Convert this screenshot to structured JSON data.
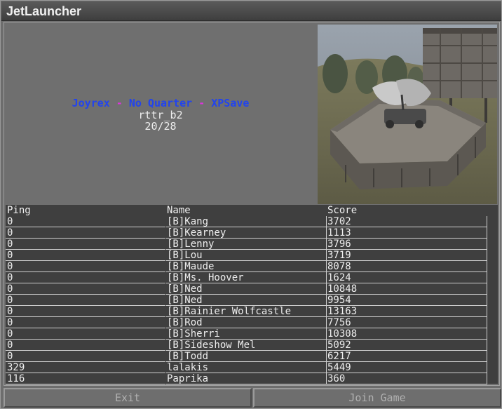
{
  "window": {
    "title": "JetLauncher"
  },
  "server": {
    "name_parts": [
      "Joyrex",
      "No Quarter",
      "XPSave"
    ],
    "separator": " - ",
    "map": "rttr_b2",
    "players": "20/28"
  },
  "table": {
    "headers": [
      "Ping",
      "Name",
      "Score"
    ],
    "rows": [
      [
        "0",
        "[B]Kang",
        "3702"
      ],
      [
        "0",
        "[B]Kearney",
        "1113"
      ],
      [
        "0",
        "[B]Lenny",
        "3796"
      ],
      [
        "0",
        "[B]Lou",
        "3719"
      ],
      [
        "0",
        "[B]Maude",
        "8078"
      ],
      [
        "0",
        "[B]Ms. Hoover",
        "1624"
      ],
      [
        "0",
        "[B]Ned",
        "10848"
      ],
      [
        "0",
        "[B]Ned",
        "9954"
      ],
      [
        "0",
        "[B]Rainier Wolfcastle",
        "13163"
      ],
      [
        "0",
        "[B]Rod",
        "7756"
      ],
      [
        "0",
        "[B]Sherri",
        "10308"
      ],
      [
        "0",
        "[B]Sideshow Mel",
        "5092"
      ],
      [
        "0",
        "[B]Todd",
        "6217"
      ],
      [
        "329",
        "lalakis",
        "5449"
      ],
      [
        "116",
        "Paprika",
        "360"
      ]
    ]
  },
  "buttons": {
    "exit": "Exit",
    "join": "Join Game"
  },
  "colors": {
    "server_name": "#2244ee",
    "separator": "#dd33dd",
    "text": "#ededed"
  }
}
